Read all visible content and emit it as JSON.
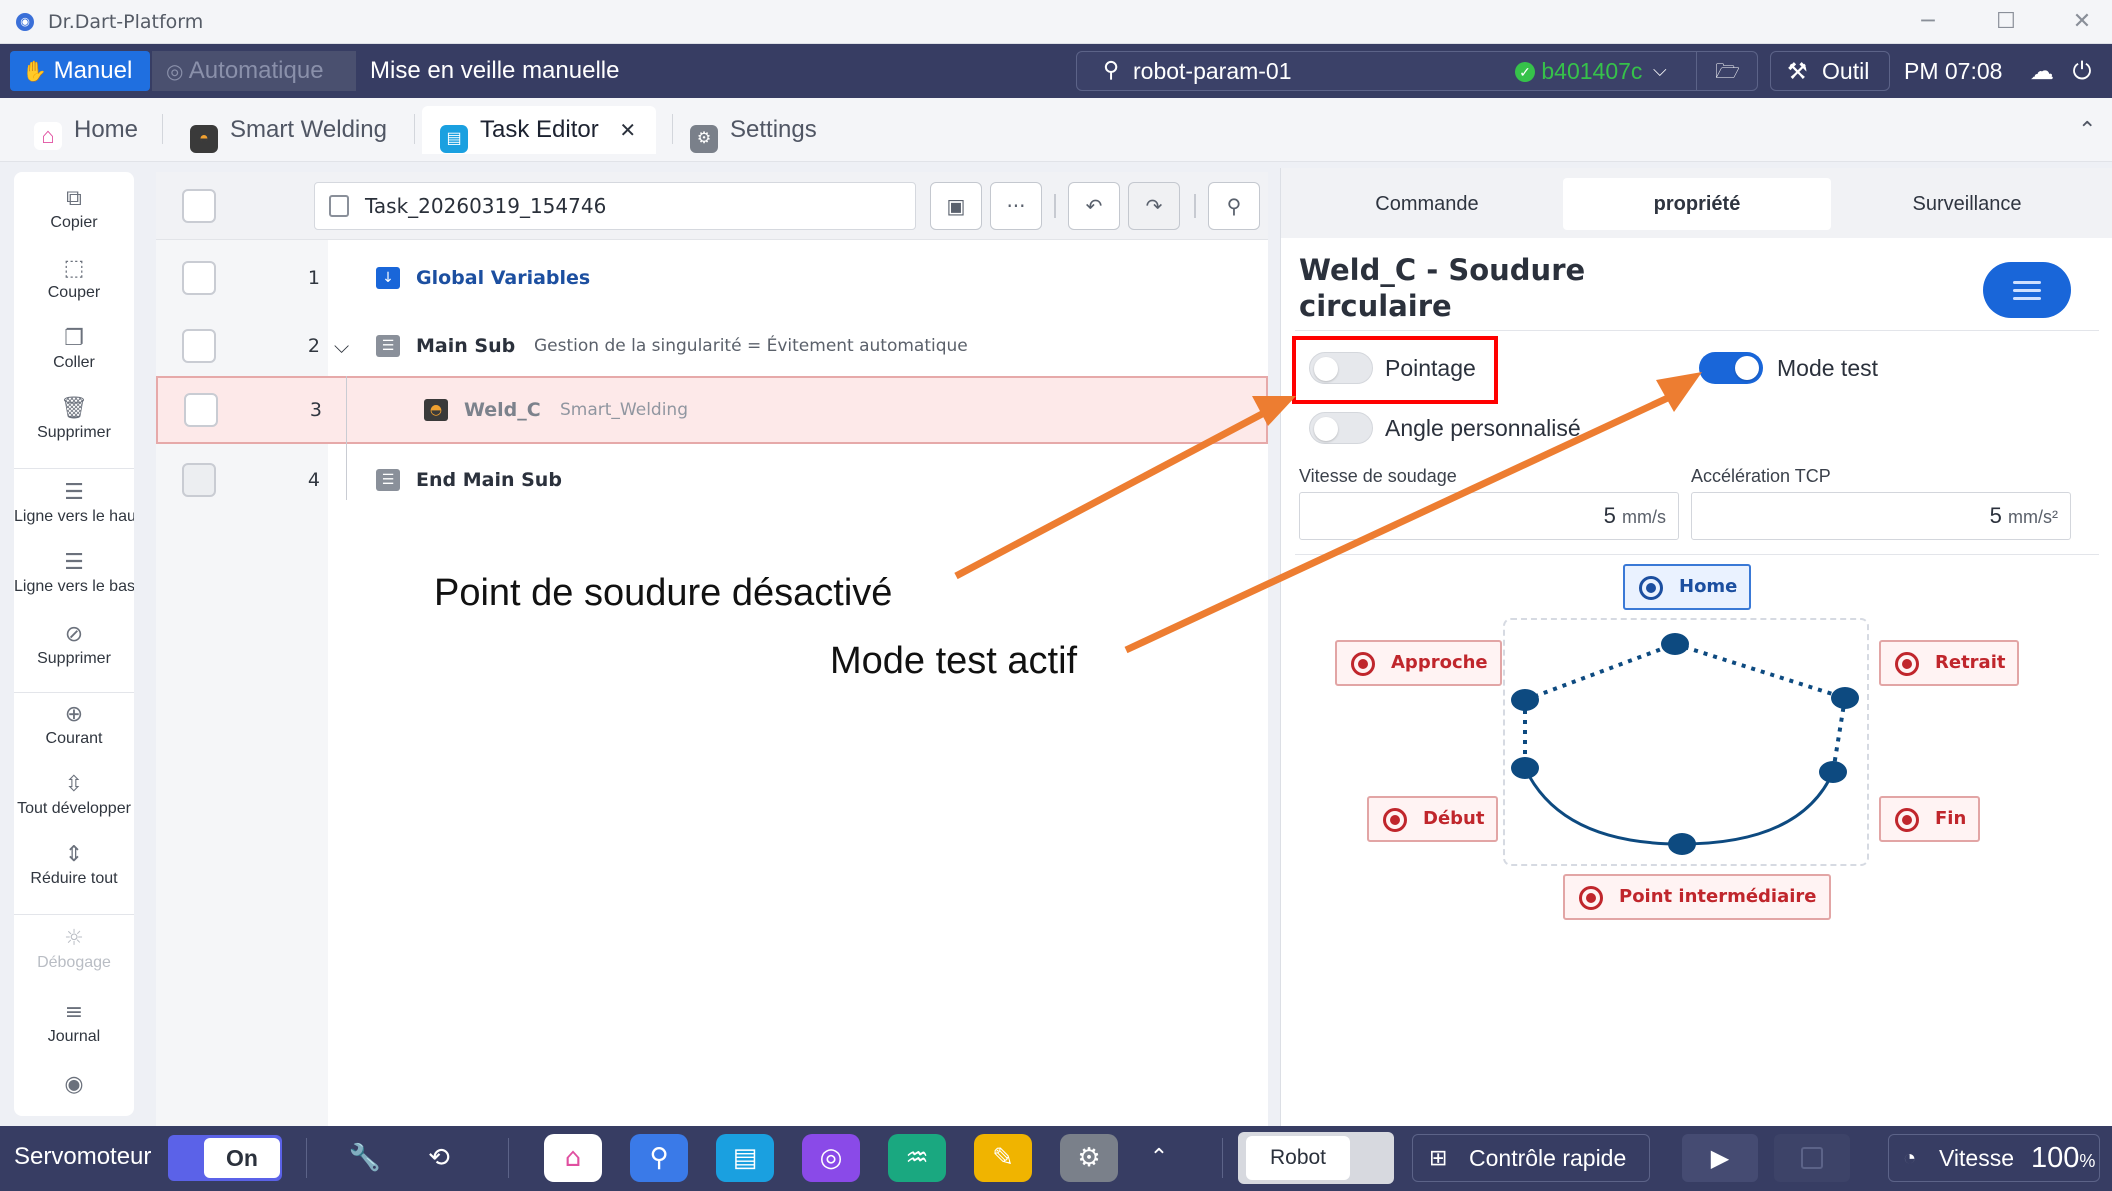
{
  "window": {
    "title": "Dr.Dart-Platform",
    "minimize": "─",
    "maximize": "☐",
    "close": "✕"
  },
  "modebar": {
    "manuel": "Manuel",
    "automatique": "Automatique",
    "veille": "Mise en veille manuelle",
    "robot_name": "robot-param-01",
    "robot_hash": "b401407c",
    "chevron": "⌵",
    "outil": "Outil",
    "clock": "PM 07:08"
  },
  "tabs": {
    "home": "Home",
    "smart_welding": "Smart Welding",
    "task_editor": "Task Editor",
    "task_editor_close": "✕",
    "settings": "Settings",
    "collapse": "⌃"
  },
  "lefttool": {
    "copier": "Copier",
    "couper": "Couper",
    "coller": "Coller",
    "supprimer": "Supprimer",
    "ligne_haut": "Ligne vers le haut",
    "ligne_bas": "Ligne vers le bas",
    "supprimer2": "Supprimer",
    "courant": "Courant",
    "tout_developper": "Tout développer",
    "reduire_tout": "Réduire tout",
    "debogage": "Débogage",
    "journal": "Journal"
  },
  "task": {
    "name": "Task_20260319_154746",
    "more": "···",
    "rows": [
      {
        "num": "1",
        "label": "Global Variables",
        "desc": ""
      },
      {
        "num": "2",
        "label": "Main Sub",
        "desc": "Gestion de la singularité = Évitement automatique"
      },
      {
        "num": "3",
        "label": "Weld_C",
        "desc": "Smart_Welding"
      },
      {
        "num": "4",
        "label": "End Main Sub",
        "desc": ""
      }
    ]
  },
  "rightpanel": {
    "tabs": {
      "commande": "Commande",
      "propriete": "propriété",
      "surveillance": "Surveillance"
    },
    "title": "Weld_C - Soudure circulaire",
    "pointage": {
      "label": "Pointage",
      "on": false
    },
    "mode_test": {
      "label": "Mode test",
      "on": true
    },
    "angle": {
      "label": "Angle personnalisé",
      "on": false
    },
    "vitesse": {
      "label": "Vitesse de soudage",
      "value": "5",
      "unit": "mm/s"
    },
    "accel": {
      "label": "Accélération TCP",
      "value": "5",
      "unit": "mm/s²"
    },
    "points": {
      "home": "Home",
      "approche": "Approche",
      "retrait": "Retrait",
      "debut": "Début",
      "fin": "Fin",
      "intermediaire": "Point intermédiaire"
    }
  },
  "annotations": {
    "pointage_off": "Point de soudure désactivé",
    "mode_test_on": "Mode test actif",
    "arrow_color": "#ed7d31",
    "box_color": "#ff0000"
  },
  "bottombar": {
    "servo": "Servomoteur",
    "on": "On",
    "robot": "Robot",
    "controle": "Contrôle rapide",
    "vitesse": "Vitesse",
    "vitesse_val": "100",
    "vitesse_unit": "%",
    "chevron_up": "⌃"
  },
  "colors": {
    "accent": "#1966d9",
    "bar": "#373d63",
    "selected_row": "#fde9e9",
    "point_red": "#c0262c",
    "diagram": "#0d4a80",
    "hash_green": "#36c24a"
  }
}
